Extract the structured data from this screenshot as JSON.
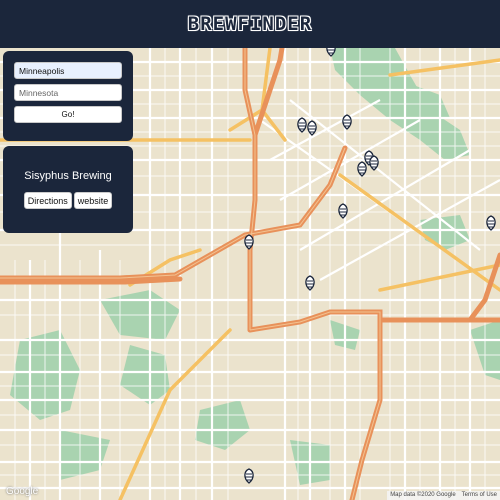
{
  "app": {
    "title": "BREWFINDER"
  },
  "search": {
    "city_value": "Minneapolis",
    "state_placeholder": "Minnesota",
    "go_label": "Go!"
  },
  "info": {
    "brewery_name": "Sisyphus Brewing",
    "directions_label": "Directions",
    "website_label": "website"
  },
  "map": {
    "google_logo": "Google",
    "attribution": "Map data ©2020 Google",
    "terms": "Terms of Use",
    "marker_icon": "hop-icon",
    "marker_count": 14
  },
  "colors": {
    "header_bg": "#1b263b",
    "land": "#ebe3cd",
    "park": "#a9d3b0",
    "highway": "#e8915a",
    "arterial": "#f5c163",
    "marker": "#1b263b"
  }
}
